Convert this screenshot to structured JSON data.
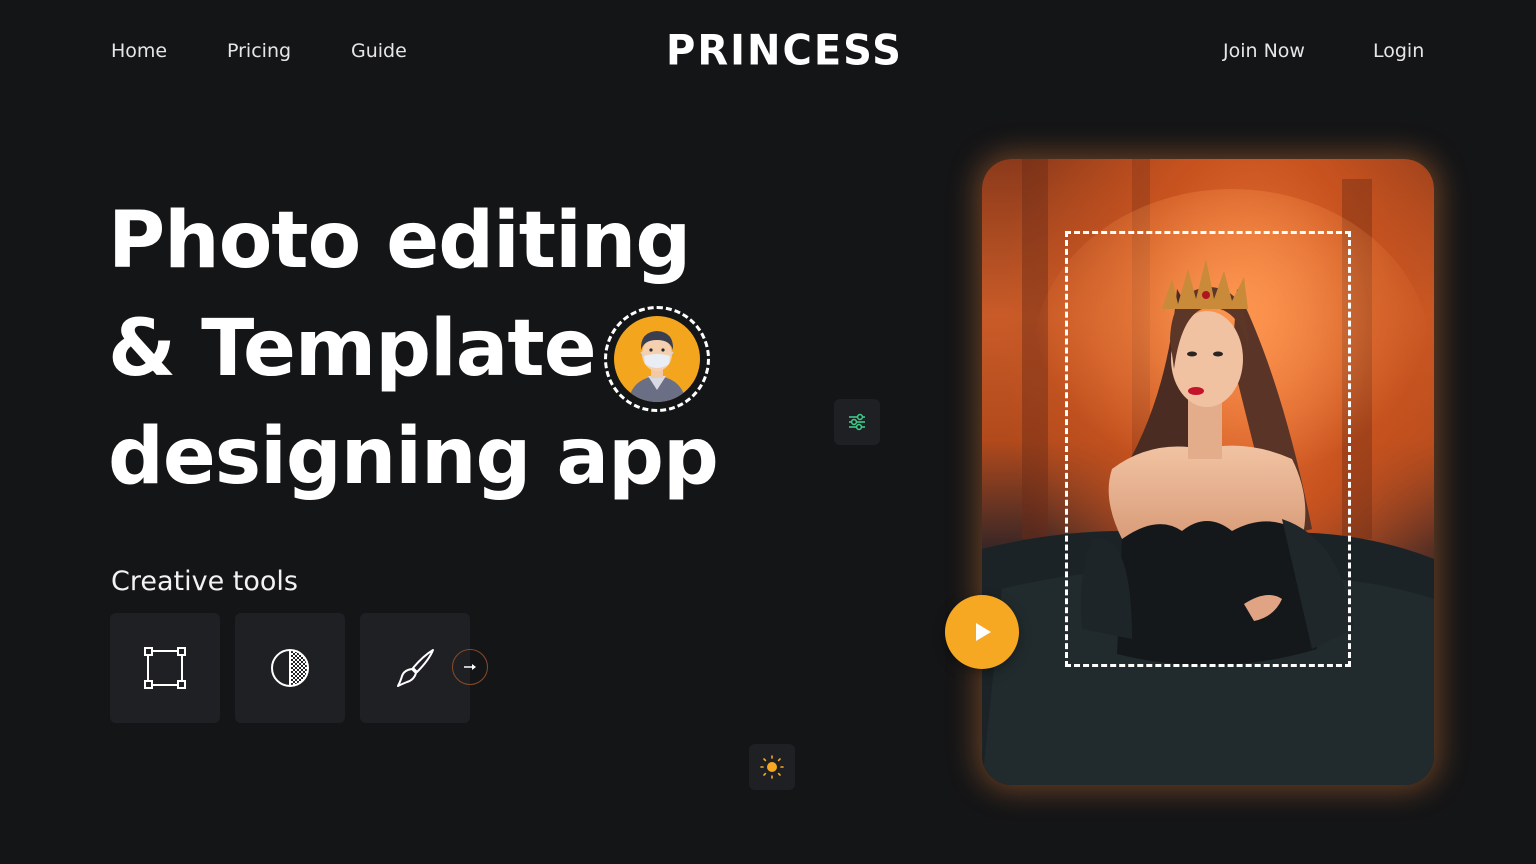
{
  "nav": {
    "left": [
      {
        "label": "Home"
      },
      {
        "label": "Pricing"
      },
      {
        "label": "Guide"
      }
    ],
    "logo": "PRINCESS",
    "right": [
      {
        "label": "Join Now"
      },
      {
        "label": "Login"
      }
    ]
  },
  "hero": {
    "line1": "Photo editing",
    "line2": "& Template",
    "line3": "designing app",
    "avatar_icon": "masked-man-avatar-icon"
  },
  "tools": {
    "title": "Creative tools",
    "items": [
      {
        "icon": "crop-square-icon"
      },
      {
        "icon": "contrast-icon"
      },
      {
        "icon": "brush-icon"
      }
    ],
    "next_icon": "arrow-right-icon"
  },
  "floating": {
    "adjust_icon": "sliders-icon",
    "brightness_icon": "sun-icon"
  },
  "media": {
    "play_icon": "play-icon"
  },
  "colors": {
    "background": "#141517",
    "accent": "#f7a823",
    "tile": "#1f2023",
    "slider_green": "#3ec98a"
  }
}
